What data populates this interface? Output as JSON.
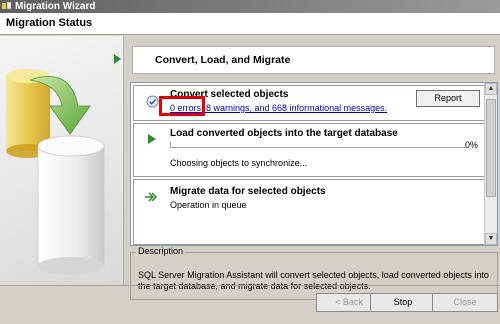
{
  "window": {
    "title": "Migration Wizard",
    "icon": "app-icon"
  },
  "header": {
    "status_label": "Migration Status"
  },
  "step": {
    "title": "Convert, Load, and Migrate"
  },
  "items": [
    {
      "title": "Convert selected objects",
      "summary_link": "0 errors, 8 warnings, and 668 informational messages.",
      "report_label": "Report",
      "icon": "check-circle-icon"
    },
    {
      "title": "Load converted objects into the target database",
      "progress_percent": "0%",
      "status_text": "Choosing objects to synchronize...",
      "icon": "play-icon"
    },
    {
      "title": "Migrate data for selected objects",
      "status_text": "Operation in queue",
      "icon": "double-arrow-icon"
    }
  ],
  "description": {
    "label": "Description",
    "text": "SQL Server Migration Assistant will convert selected objects, load converted objects into the target database, and migrate data for selected objects."
  },
  "footer": {
    "back_label": "< Back",
    "stop_label": "Stop",
    "close_label": "Close"
  },
  "colors": {
    "accent_green": "#2e8b2e",
    "link_blue": "#0000cc",
    "highlight_red": "#e00000"
  }
}
